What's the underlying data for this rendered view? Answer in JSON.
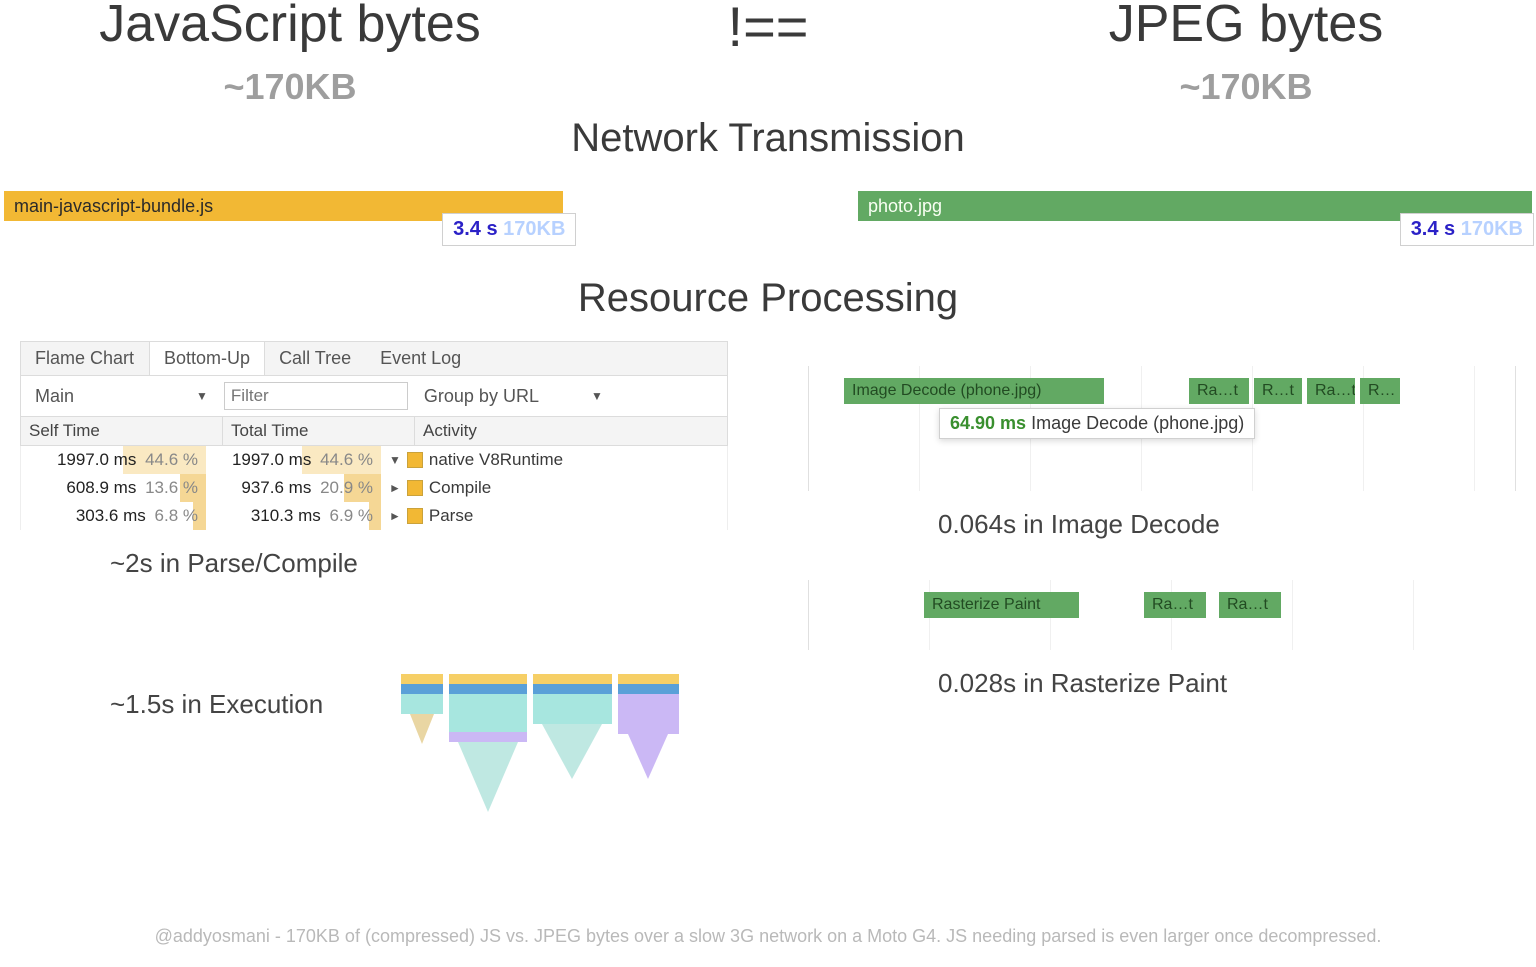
{
  "header": {
    "left_title": "JavaScript bytes",
    "right_title": "JPEG bytes",
    "neq": "!==",
    "left_kb": "~170KB",
    "right_kb": "~170KB"
  },
  "network": {
    "title": "Network Transmission",
    "js_file": "main-javascript-bundle.js",
    "jpeg_file": "photo.jpg",
    "js_time": "3.4 s",
    "js_size": "170KB",
    "jpeg_time": "3.4 s",
    "jpeg_size": "170KB"
  },
  "processing": {
    "title": "Resource Processing"
  },
  "devtools": {
    "tabs": {
      "t1": "Flame Chart",
      "t2": "Bottom-Up",
      "t3": "Call Tree",
      "t4": "Event Log"
    },
    "thread": "Main",
    "filter_placeholder": "Filter",
    "group": "Group by URL",
    "cols": {
      "self": "Self Time",
      "total": "Total Time",
      "act": "Activity"
    },
    "rows": [
      {
        "self_ms": "1997.0 ms",
        "self_pct": "44.6 %",
        "total_ms": "1997.0 ms",
        "total_pct": "44.6 %",
        "tri": "▼",
        "act": "native V8Runtime",
        "sw": 45,
        "tw": 45
      },
      {
        "self_ms": "608.9 ms",
        "self_pct": "13.6 %",
        "total_ms": "937.6 ms",
        "total_pct": "20.9 %",
        "tri": "►",
        "act": "Compile",
        "sw": 14,
        "tw": 21
      },
      {
        "self_ms": "303.6 ms",
        "self_pct": "6.8 %",
        "total_ms": "310.3 ms",
        "total_pct": "6.9 %",
        "tri": "►",
        "act": "Parse",
        "sw": 7,
        "tw": 7
      }
    ]
  },
  "right_timeline": {
    "main": "Image Decode (phone.jpg)",
    "tip_ms": "64.90 ms",
    "tip_label": "Image Decode (phone.jpg)",
    "small1": "Ra…t",
    "small2": "R…t",
    "small3": "Ra…t",
    "small4": "R…"
  },
  "summaries": {
    "js_parse": "~2s in Parse/Compile",
    "img_decode": "0.064s in Image Decode",
    "js_exec": "~1.5s in Execution",
    "raster": "0.028s in Rasterize Paint"
  },
  "raster_row": {
    "b1": "Rasterize Paint",
    "b2": "Ra…t",
    "b3": "Ra…t"
  },
  "footer": "@addyosmani - 170KB of (compressed) JS vs. JPEG bytes over a slow 3G network on a Moto G4. JS needing parsed is even larger once decompressed."
}
